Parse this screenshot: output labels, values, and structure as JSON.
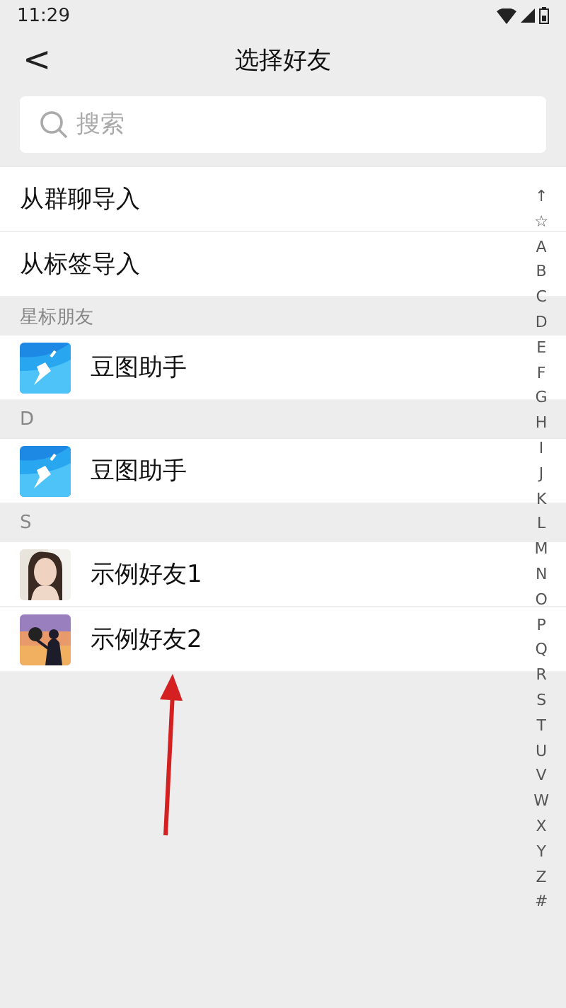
{
  "status_bar": {
    "time": "11:29"
  },
  "header": {
    "back": "<",
    "title": "选择好友"
  },
  "search": {
    "placeholder": "搜索"
  },
  "actions": [
    "从群聊导入",
    "从标签导入"
  ],
  "sections": [
    {
      "title": "星标朋友",
      "friends": [
        {
          "name": "豆图助手",
          "kind": "app"
        }
      ]
    },
    {
      "title": "D",
      "friends": [
        {
          "name": "豆图助手",
          "kind": "app"
        }
      ]
    },
    {
      "title": "S",
      "friends": [
        {
          "name": "示例好友1",
          "kind": "picture"
        },
        {
          "name": "示例好友2",
          "kind": "picture"
        }
      ]
    }
  ],
  "index": [
    "↑",
    "☆",
    "A",
    "B",
    "C",
    "D",
    "E",
    "F",
    "G",
    "H",
    "I",
    "J",
    "K",
    "L",
    "M",
    "N",
    "O",
    "P",
    "Q",
    "R",
    "S",
    "T",
    "U",
    "V",
    "W",
    "X",
    "Y",
    "Z",
    "#"
  ]
}
